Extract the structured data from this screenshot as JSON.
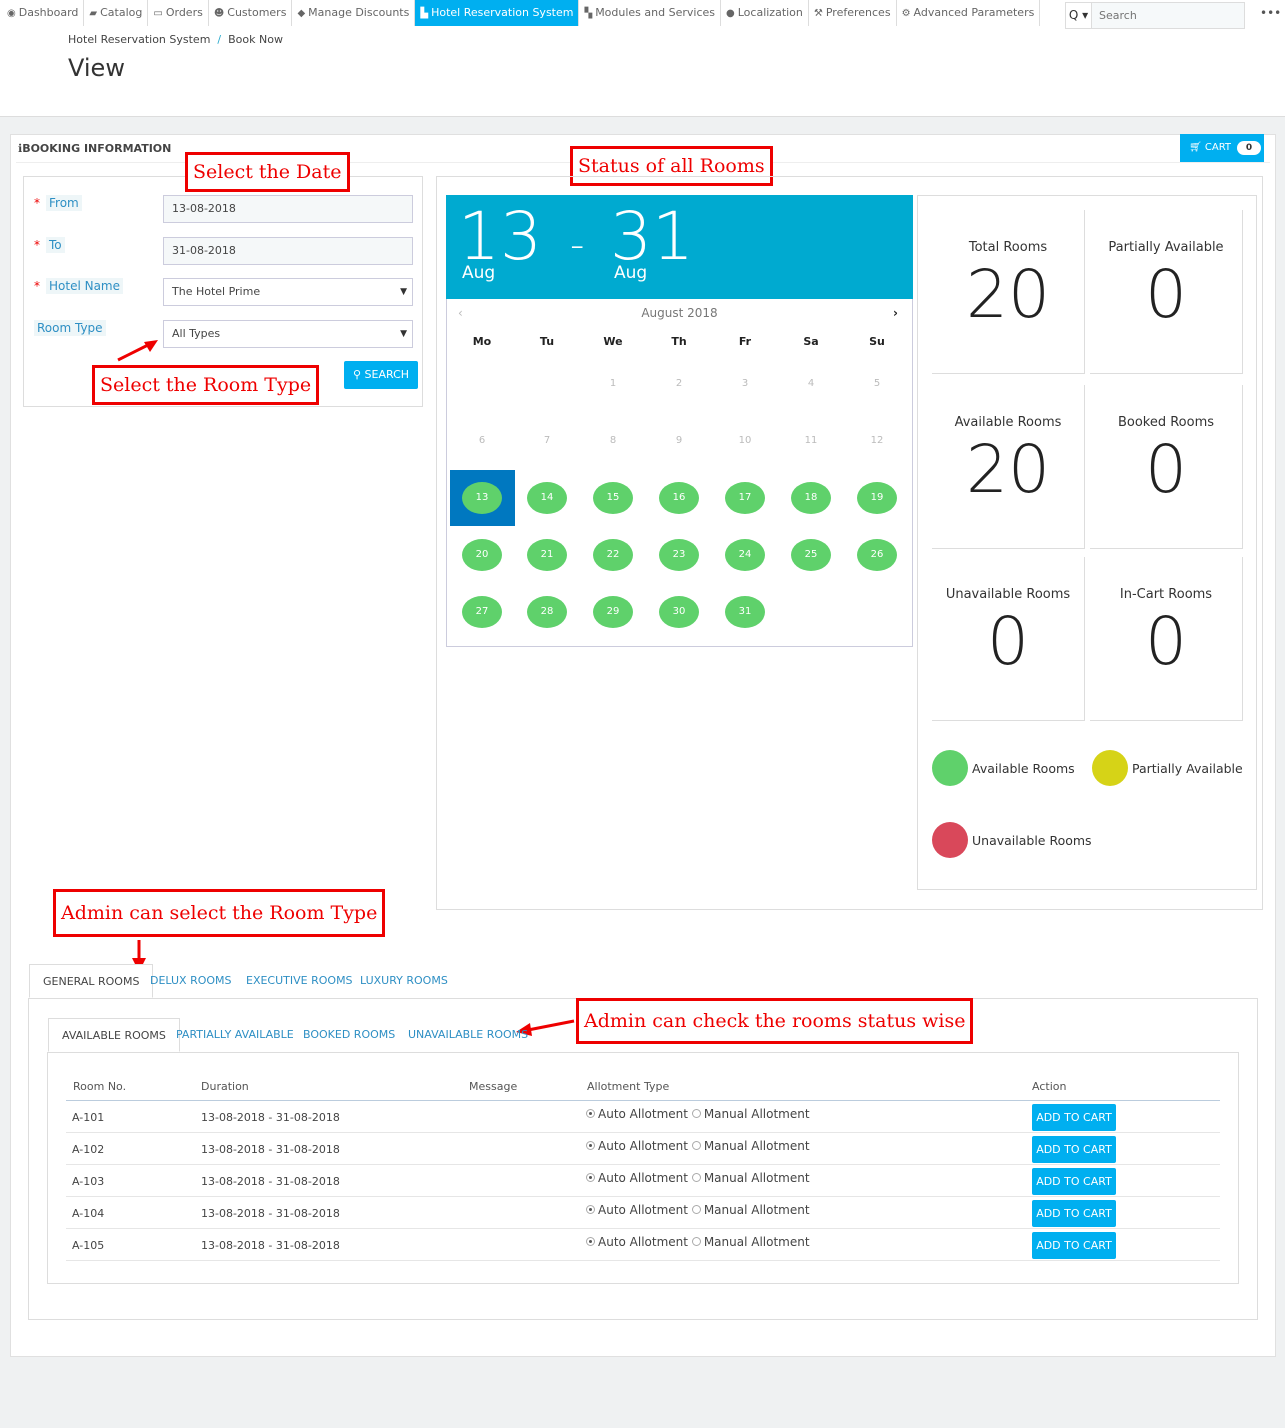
{
  "nav": {
    "items": [
      {
        "label": "Dashboard",
        "icon": "dashboard-icon",
        "glyph": "◉"
      },
      {
        "label": "Catalog",
        "icon": "book-icon",
        "glyph": "▰"
      },
      {
        "label": "Orders",
        "icon": "credit-card-icon",
        "glyph": "▭"
      },
      {
        "label": "Customers",
        "icon": "users-icon",
        "glyph": "☻"
      },
      {
        "label": "Manage Discounts",
        "icon": "tag-icon",
        "glyph": "◆"
      },
      {
        "label": "Hotel Reservation System",
        "icon": "bed-icon",
        "glyph": "▙",
        "active": true
      },
      {
        "label": "Modules and Services",
        "icon": "puzzle-icon",
        "glyph": "▚"
      },
      {
        "label": "Localization",
        "icon": "globe-icon",
        "glyph": "●"
      },
      {
        "label": "Preferences",
        "icon": "wrench-icon",
        "glyph": "⚒"
      },
      {
        "label": "Advanced Parameters",
        "icon": "cogs-icon",
        "glyph": "⚙"
      }
    ],
    "search_placeholder": "Search",
    "more": "•••"
  },
  "breadcrumb": [
    "Hotel Reservation System",
    "Book Now"
  ],
  "page_title": "View",
  "panel": {
    "title": "BOOKING INFORMATION",
    "cart_label": "CART",
    "cart_count": "0"
  },
  "form": {
    "from_label": "From",
    "from_value": "13-08-2018",
    "to_label": "To",
    "to_value": "31-08-2018",
    "hotel_label": "Hotel Name",
    "hotel_value": "The Hotel Prime",
    "room_type_label": "Room Type",
    "room_type_value": "All Types",
    "search_label": "SEARCH"
  },
  "annotations": {
    "date": "Select the Date",
    "status": "Status of all Rooms",
    "room_type": "Select the Room Type",
    "admin_room_type": "Admin can select the Room Type",
    "admin_status": "Admin can check the rooms status wise"
  },
  "calendar": {
    "from_day": "13",
    "from_month": "Aug",
    "dash": "-",
    "to_day": "31",
    "to_month": "Aug",
    "month_title": "August 2018",
    "days_of_week": [
      "Mo",
      "Tu",
      "We",
      "Th",
      "Fr",
      "Sa",
      "Su"
    ],
    "first_weekday": 2,
    "days_in_month": 31,
    "selected_start": 13,
    "selected_end": 31
  },
  "stats": [
    {
      "label": "Total Rooms",
      "value": "20"
    },
    {
      "label": "Partially Available",
      "value": "0"
    },
    {
      "label": "Available Rooms",
      "value": "20"
    },
    {
      "label": "Booked Rooms",
      "value": "0"
    },
    {
      "label": "Unavailable Rooms",
      "value": "0"
    },
    {
      "label": "In-Cart Rooms",
      "value": "0"
    }
  ],
  "legend": [
    {
      "label": "Available Rooms",
      "color": "#5fd16b"
    },
    {
      "label": "Partially Available",
      "color": "#d6d317"
    },
    {
      "label": "Unavailable Rooms",
      "color": "#d9485a"
    }
  ],
  "room_tabs": [
    "GENERAL ROOMS",
    "DELUX ROOMS",
    "EXECUTIVE ROOMS",
    "LUXURY ROOMS"
  ],
  "status_tabs": [
    "AVAILABLE ROOMS",
    "PARTIALLY AVAILABLE",
    "BOOKED ROOMS",
    "UNAVAILABLE ROOMS"
  ],
  "table": {
    "headers": [
      "Room No.",
      "Duration",
      "Message",
      "Allotment Type",
      "Action"
    ],
    "rows": [
      {
        "room": "A-101",
        "duration": "13-08-2018 - 31-08-2018",
        "message": ""
      },
      {
        "room": "A-102",
        "duration": "13-08-2018 - 31-08-2018",
        "message": ""
      },
      {
        "room": "A-103",
        "duration": "13-08-2018 - 31-08-2018",
        "message": ""
      },
      {
        "room": "A-104",
        "duration": "13-08-2018 - 31-08-2018",
        "message": ""
      },
      {
        "room": "A-105",
        "duration": "13-08-2018 - 31-08-2018",
        "message": ""
      }
    ],
    "auto_label": "Auto Allotment",
    "manual_label": "Manual Allotment",
    "action_label": "ADD TO CART"
  }
}
